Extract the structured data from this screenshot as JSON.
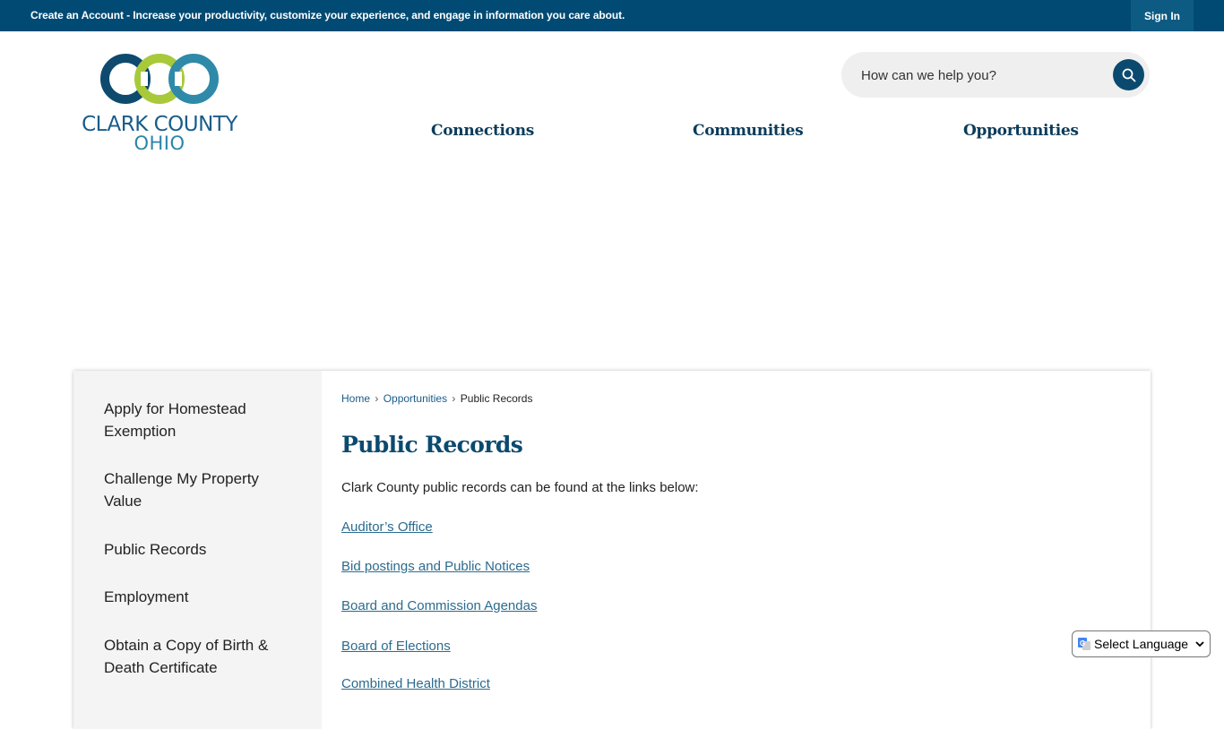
{
  "topbar": {
    "create_account": "Create an Account",
    "message": " - Increase your productivity, customize your experience, and engage in information you care about.",
    "sign_in": "Sign In"
  },
  "logo": {
    "line1": "CLARK COUNTY",
    "line2": "OHIO",
    "colors": {
      "dark": "#0d4a6e",
      "green": "#a8c93a",
      "teal": "#2e8aa8"
    }
  },
  "search": {
    "placeholder": "How can we help you?",
    "icon": "search-icon"
  },
  "nav": {
    "items": [
      "Connections",
      "Communities",
      "Opportunities"
    ]
  },
  "sidebar": {
    "items": [
      "Apply for Homestead Exemption",
      "Challenge My Property Value",
      "Public Records",
      "Employment",
      "Obtain a Copy of Birth & Death Certificate"
    ]
  },
  "breadcrumb": {
    "home": "Home",
    "section": "Opportunities",
    "current": "Public Records",
    "separator": "›"
  },
  "page": {
    "title": "Public Records",
    "intro": "Clark County public records can be found at the links below:",
    "links": [
      "Auditor’s Office",
      "Bid postings and Public Notices",
      "Board and Commission Agendas",
      "Board of Elections",
      "Combined Health District"
    ]
  },
  "language": {
    "label": "Select Language"
  },
  "colors": {
    "topbar": "#004a73",
    "accent": "#0b4a6f",
    "link": "#2b6b8f"
  }
}
